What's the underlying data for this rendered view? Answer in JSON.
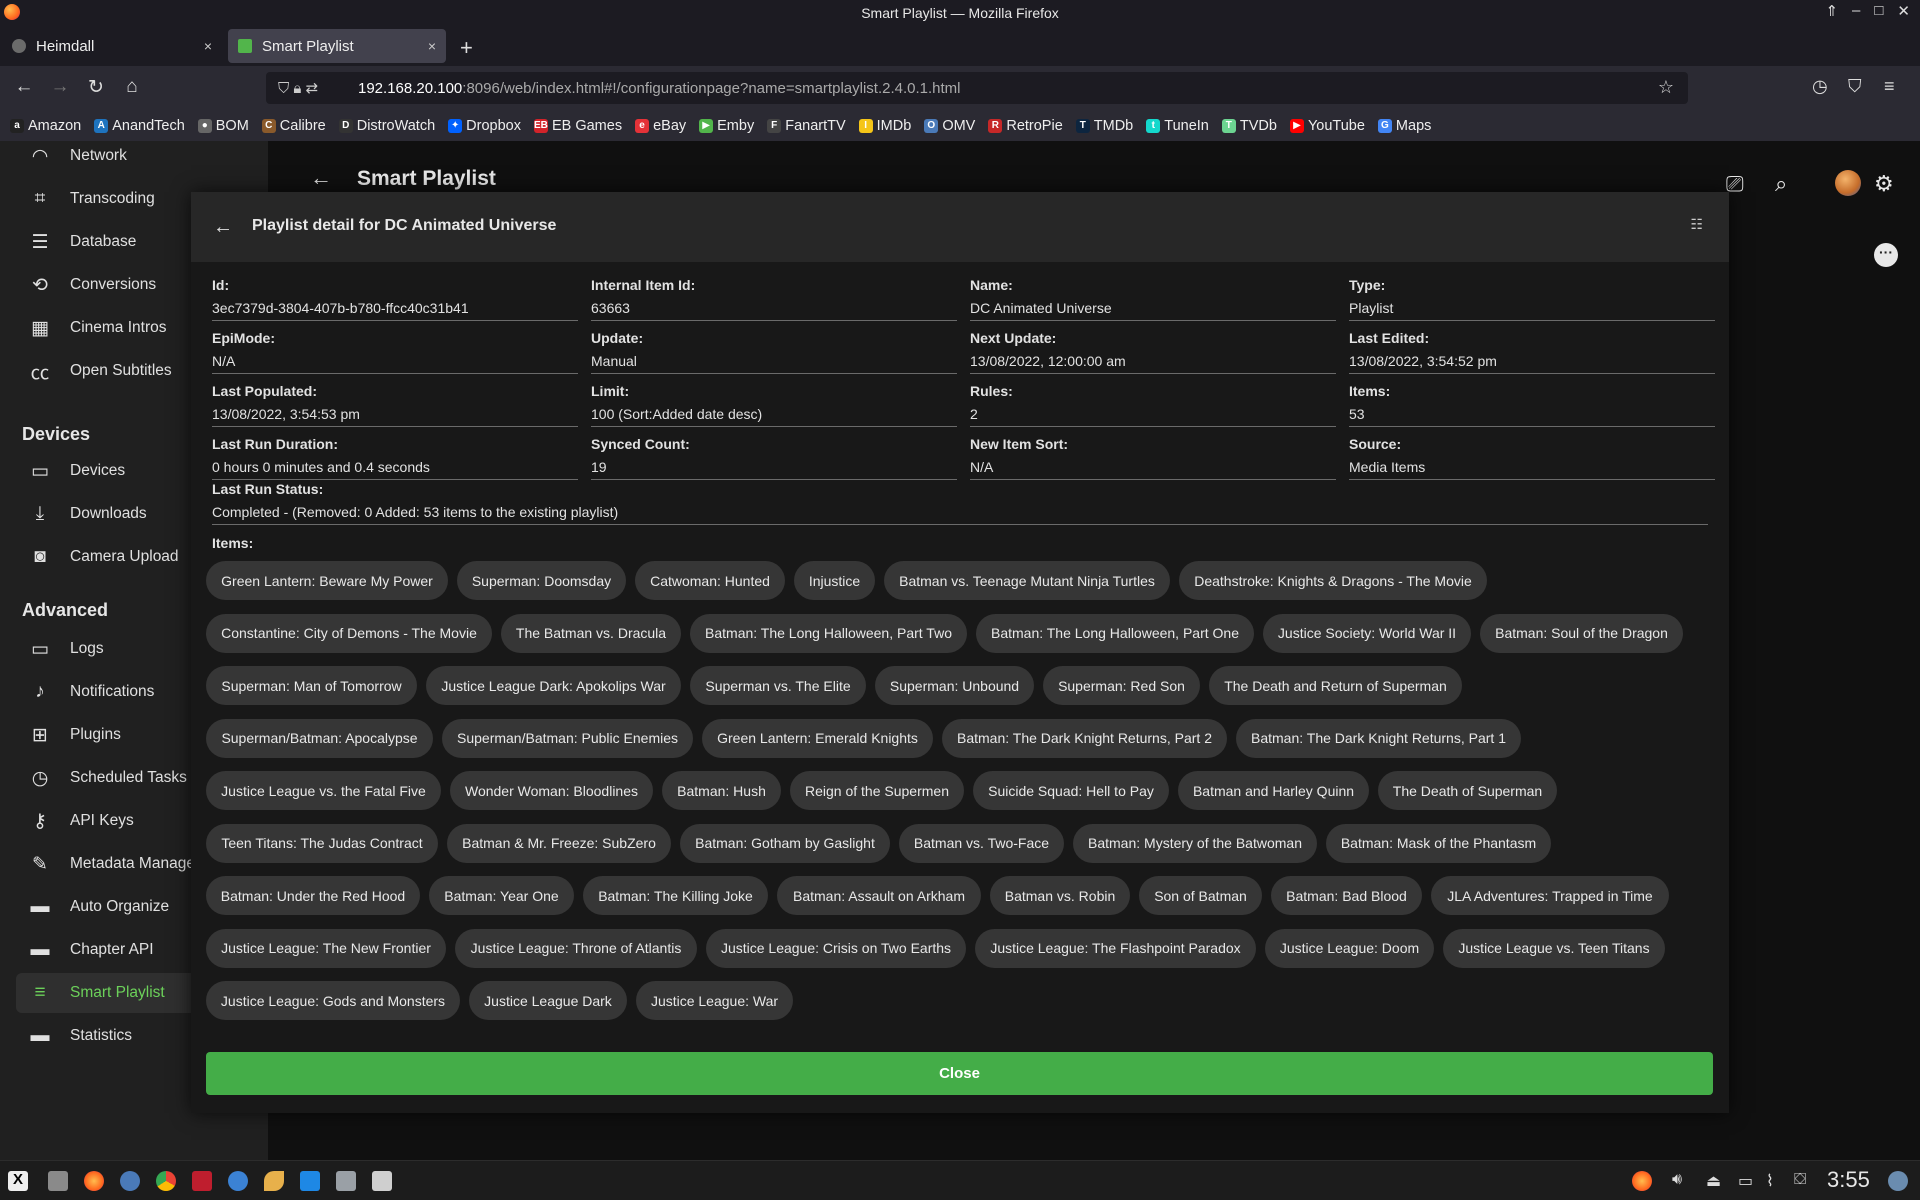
{
  "window": {
    "title": "Smart Playlist — Mozilla Firefox"
  },
  "tabs": [
    {
      "label": "Heimdall",
      "close": "×"
    },
    {
      "label": "Smart Playlist",
      "close": "×"
    }
  ],
  "newtab": "+",
  "url": {
    "host": "192.168.20.100",
    "rest": ":8096/web/index.html#!/configurationpage?name=smartplaylist.2.4.0.1.html"
  },
  "bookmarks": [
    {
      "label": "Amazon",
      "icon": "a",
      "color": "#222"
    },
    {
      "label": "AnandTech",
      "icon": "A",
      "color": "#1e73be"
    },
    {
      "label": "BOM",
      "icon": "●",
      "color": "#666"
    },
    {
      "label": "Calibre",
      "icon": "C",
      "color": "#8a5a2b"
    },
    {
      "label": "DistroWatch",
      "icon": "D",
      "color": "#333"
    },
    {
      "label": "Dropbox",
      "icon": "✦",
      "color": "#0061fe"
    },
    {
      "label": "EB Games",
      "icon": "EB",
      "color": "#d2232a"
    },
    {
      "label": "eBay",
      "icon": "e",
      "color": "#e53238"
    },
    {
      "label": "Emby",
      "icon": "▶",
      "color": "#52b54b"
    },
    {
      "label": "FanartTV",
      "icon": "F",
      "color": "#444"
    },
    {
      "label": "IMDb",
      "icon": "I",
      "color": "#f5c518"
    },
    {
      "label": "OMV",
      "icon": "O",
      "color": "#4a7ab8"
    },
    {
      "label": "RetroPie",
      "icon": "R",
      "color": "#c62828"
    },
    {
      "label": "TMDb",
      "icon": "T",
      "color": "#0d253f"
    },
    {
      "label": "TuneIn",
      "icon": "t",
      "color": "#14d8cc"
    },
    {
      "label": "TVDb",
      "icon": "T",
      "color": "#6cd491"
    },
    {
      "label": "YouTube",
      "icon": "▶",
      "color": "#ff0000"
    },
    {
      "label": "Maps",
      "icon": "G",
      "color": "#4285f4"
    }
  ],
  "sidebar": {
    "items_top": [
      {
        "label": "Network",
        "icon": "wifi-icon",
        "glyph": "◠"
      },
      {
        "label": "Transcoding",
        "icon": "crop-icon",
        "glyph": "⌗"
      },
      {
        "label": "Database",
        "icon": "list-icon",
        "glyph": "☰"
      },
      {
        "label": "Conversions",
        "icon": "sync-icon",
        "glyph": "⟲"
      },
      {
        "label": "Cinema Intros",
        "icon": "film-icon",
        "glyph": "▦"
      },
      {
        "label": "Open Subtitles",
        "icon": "cc-icon",
        "glyph": "㏄"
      }
    ],
    "devices_heading": "Devices",
    "items_devices": [
      {
        "label": "Devices",
        "icon": "devices-icon",
        "glyph": "▭"
      },
      {
        "label": "Downloads",
        "icon": "download-icon",
        "glyph": "⤓"
      },
      {
        "label": "Camera Upload",
        "icon": "camera-icon",
        "glyph": "◙"
      }
    ],
    "advanced_heading": "Advanced",
    "items_advanced": [
      {
        "label": "Logs",
        "icon": "folder-icon",
        "glyph": "▭"
      },
      {
        "label": "Notifications",
        "icon": "bell-icon",
        "glyph": "♪"
      },
      {
        "label": "Plugins",
        "icon": "cart-icon",
        "glyph": "⊞"
      },
      {
        "label": "Scheduled Tasks",
        "icon": "clock-icon",
        "glyph": "◷"
      },
      {
        "label": "API Keys",
        "icon": "key-icon",
        "glyph": "⚷"
      },
      {
        "label": "Metadata Manager",
        "icon": "pencil-icon",
        "glyph": "✎"
      },
      {
        "label": "Auto Organize",
        "icon": "folder-icon",
        "glyph": "▬"
      },
      {
        "label": "Chapter API",
        "icon": "folder-icon",
        "glyph": "▬"
      },
      {
        "label": "Smart Playlist",
        "icon": "playlist-icon",
        "glyph": "≡",
        "active": true
      },
      {
        "label": "Statistics",
        "icon": "folder-icon",
        "glyph": "▬"
      }
    ]
  },
  "page": {
    "title": "Smart Playlist"
  },
  "dialog": {
    "title": "Playlist detail for DC Animated Universe",
    "fields": [
      {
        "label": "Id:",
        "value": "3ec7379d-3804-407b-b780-ffcc40c31b41"
      },
      {
        "label": "Internal Item Id:",
        "value": "63663"
      },
      {
        "label": "Name:",
        "value": "DC Animated Universe"
      },
      {
        "label": "Type:",
        "value": "Playlist"
      },
      {
        "label": "EpiMode:",
        "value": "N/A"
      },
      {
        "label": "Update:",
        "value": "Manual"
      },
      {
        "label": "Next Update:",
        "value": "13/08/2022, 12:00:00 am"
      },
      {
        "label": "Last Edited:",
        "value": "13/08/2022, 3:54:52 pm"
      },
      {
        "label": "Last Populated:",
        "value": "13/08/2022, 3:54:53 pm"
      },
      {
        "label": "Limit:",
        "value": "100 (Sort:Added date desc)"
      },
      {
        "label": "Rules:",
        "value": "2"
      },
      {
        "label": "Items:",
        "value": "53"
      },
      {
        "label": "Last Run Duration:",
        "value": "0 hours 0 minutes and 0.4 seconds"
      },
      {
        "label": "Synced Count:",
        "value": "19"
      },
      {
        "label": "New Item Sort:",
        "value": "N/A"
      },
      {
        "label": "Source:",
        "value": "Media Items"
      }
    ],
    "status": {
      "label": "Last Run Status:",
      "value": "Completed - (Removed: 0 Added: 53 items to the existing playlist)"
    },
    "items_label": "Items:",
    "items": [
      [
        "Green Lantern: Beware My Power",
        "Superman: Doomsday",
        "Catwoman: Hunted",
        "Injustice",
        "Batman vs. Teenage Mutant Ninja Turtles",
        "Deathstroke: Knights & Dragons - The Movie"
      ],
      [
        "Constantine: City of Demons - The Movie",
        "The Batman vs. Dracula",
        "Batman: The Long Halloween, Part Two",
        "Batman: The Long Halloween, Part One",
        "Justice Society: World War II",
        "Batman: Soul of the Dragon"
      ],
      [
        "Superman: Man of Tomorrow",
        "Justice League Dark: Apokolips War",
        "Superman vs. The Elite",
        "Superman: Unbound",
        "Superman: Red Son",
        "The Death and Return of Superman"
      ],
      [
        "Superman/Batman: Apocalypse",
        "Superman/Batman: Public Enemies",
        "Green Lantern: Emerald Knights",
        "Batman: The Dark Knight Returns, Part 2",
        "Batman: The Dark Knight Returns, Part 1"
      ],
      [
        "Justice League vs. the Fatal Five",
        "Wonder Woman: Bloodlines",
        "Batman: Hush",
        "Reign of the Supermen",
        "Suicide Squad: Hell to Pay",
        "Batman and Harley Quinn",
        "The Death of Superman"
      ],
      [
        "Teen Titans: The Judas Contract",
        "Batman & Mr. Freeze: SubZero",
        "Batman: Gotham by Gaslight",
        "Batman vs. Two-Face",
        "Batman: Mystery of the Batwoman",
        "Batman: Mask of the Phantasm"
      ],
      [
        "Batman: Under the Red Hood",
        "Batman: Year One",
        "Batman: The Killing Joke",
        "Batman: Assault on Arkham",
        "Batman vs. Robin",
        "Son of Batman",
        "Batman: Bad Blood",
        "JLA Adventures: Trapped in Time"
      ],
      [
        "Justice League: The New Frontier",
        "Justice League: Throne of Atlantis",
        "Justice League: Crisis on Two Earths",
        "Justice League: The Flashpoint Paradox",
        "Justice League: Doom",
        "Justice League vs. Teen Titans"
      ],
      [
        "Justice League: Gods and Monsters",
        "Justice League Dark",
        "Justice League: War"
      ]
    ],
    "close_label": "Close"
  },
  "taskbar": {
    "clock": "3:55"
  }
}
